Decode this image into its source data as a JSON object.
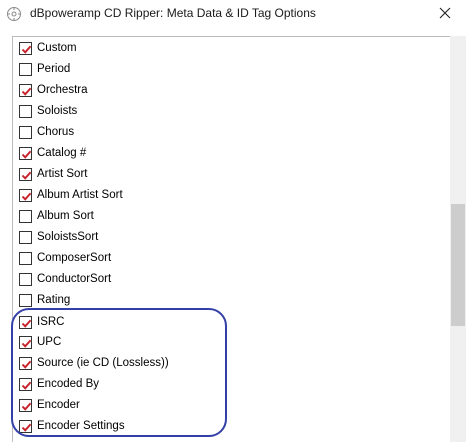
{
  "window": {
    "title": "dBpoweramp CD Ripper: Meta Data & ID Tag Options",
    "close_glyph": "✕"
  },
  "colors": {
    "check_mark": "#c8202a",
    "highlight_border": "#3440a8"
  },
  "tags": [
    {
      "label": "Custom",
      "checked": true
    },
    {
      "label": "Period",
      "checked": false
    },
    {
      "label": "Orchestra",
      "checked": true
    },
    {
      "label": "Soloists",
      "checked": false
    },
    {
      "label": "Chorus",
      "checked": false
    },
    {
      "label": "Catalog #",
      "checked": true
    },
    {
      "label": "Artist Sort",
      "checked": true
    },
    {
      "label": "Album Artist Sort",
      "checked": true
    },
    {
      "label": "Album Sort",
      "checked": false
    },
    {
      "label": "SoloistsSort",
      "checked": false
    },
    {
      "label": "ComposerSort",
      "checked": false
    },
    {
      "label": "ConductorSort",
      "checked": false
    },
    {
      "label": "Rating",
      "checked": false
    },
    {
      "label": "ISRC",
      "checked": true
    },
    {
      "label": "UPC",
      "checked": true
    },
    {
      "label": "Source (ie CD (Lossless))",
      "checked": true
    },
    {
      "label": "Encoded By",
      "checked": true
    },
    {
      "label": "Encoder",
      "checked": true
    },
    {
      "label": "Encoder Settings",
      "checked": true
    }
  ]
}
